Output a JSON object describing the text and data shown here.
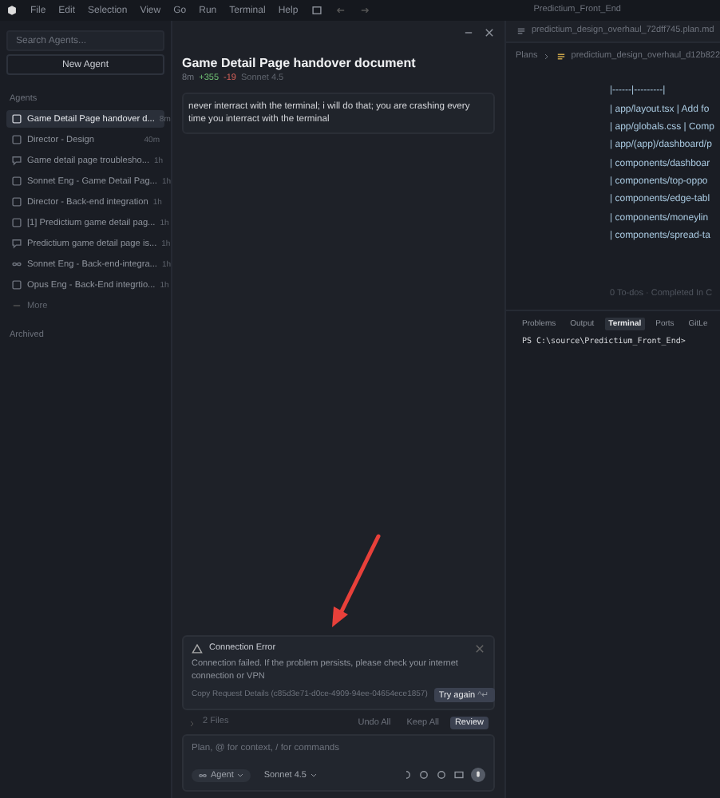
{
  "menu": [
    "File",
    "Edit",
    "Selection",
    "View",
    "Go",
    "Run",
    "Terminal",
    "Help"
  ],
  "window": {
    "title": "Predictium_Front_End"
  },
  "sidebar": {
    "search": {
      "placeholder": "Search Agents..."
    },
    "new_button": "New Agent",
    "section": "Agents",
    "items": [
      {
        "label": "Game Detail Page handover d...",
        "time": "8m",
        "kind": "doc",
        "selected": true
      },
      {
        "label": "Director - Design",
        "time": "40m",
        "kind": "doc",
        "selected": false
      },
      {
        "label": "Game detail page troublesho...",
        "time": "1h",
        "kind": "chat",
        "selected": false
      },
      {
        "label": "Sonnet Eng - Game Detail Pag...",
        "time": "1h",
        "kind": "doc",
        "selected": false
      },
      {
        "label": "Director - Back-end integration",
        "time": "1h",
        "kind": "doc",
        "selected": false
      },
      {
        "label": "[1] Predictium game detail pag...",
        "time": "1h",
        "kind": "doc",
        "selected": false
      },
      {
        "label": "Predictium game detail page is...",
        "time": "1h",
        "kind": "chat",
        "selected": false
      },
      {
        "label": "Sonnet Eng - Back-end-integra...",
        "time": "1h",
        "kind": "loop",
        "selected": false
      },
      {
        "label": "Opus Eng - Back-End integrtio...",
        "time": "1h",
        "kind": "doc",
        "selected": false
      }
    ],
    "more": "More",
    "archived": "Archived"
  },
  "chat": {
    "title": "Game Detail Page handover document",
    "meta": {
      "age": "8m",
      "added": "+355",
      "removed": "-19",
      "model": "Sonnet 4.5"
    },
    "message": "never interract with the terminal; i will do that;  you are crashing every time you interract with the terminal",
    "error": {
      "title": "Connection Error",
      "body": "Connection failed. If the problem persists, please check your internet connection or VPN",
      "details": "Copy Request Details (c85d3e71-d0ce-4909-94ee-04654ece1857)",
      "retry": "Try again",
      "shortcut": "^↵"
    },
    "files": {
      "label": "2 Files",
      "undo": "Undo All",
      "keep": "Keep All",
      "review": "Review"
    },
    "input": {
      "placeholder": "Plan, @ for context, / for commands"
    },
    "mode": "Agent",
    "model": "Sonnet 4.5"
  },
  "editor": {
    "tab": "predictium_design_overhaul_72dff745.plan.md",
    "breadcrumb": [
      "Plans",
      "predictium_design_overhaul_d12b822"
    ],
    "lines": [
      "|------|---------|",
      "| app/layout.tsx | Add fo",
      "| app/globals.css | Comp",
      "| app/(app)/dashboard/p",
      "| components/dashboar",
      "| components/top-oppo",
      "| components/edge-tabl",
      "| components/moneylin",
      "| components/spread-ta"
    ],
    "todos": "0 To-dos · Completed In C"
  },
  "panel": {
    "tabs": [
      {
        "label": "Problems",
        "selected": false
      },
      {
        "label": "Output",
        "selected": false
      },
      {
        "label": "Terminal",
        "selected": true
      },
      {
        "label": "Ports",
        "selected": false
      },
      {
        "label": "GitLe",
        "selected": false
      }
    ],
    "prompt": "PS C:\\source\\Predictium_Front_End>"
  }
}
